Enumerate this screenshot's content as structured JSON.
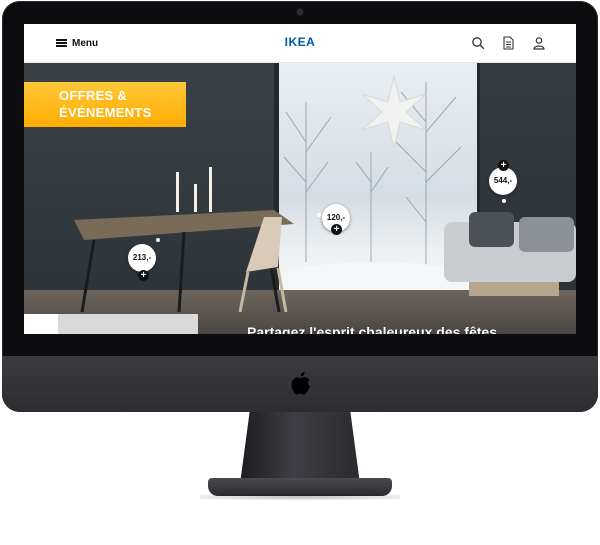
{
  "header": {
    "menu_label": "Menu",
    "logo_text": "IKEA",
    "icons": [
      "search-icon",
      "document-icon",
      "user-icon"
    ]
  },
  "hero": {
    "promo_title_line1": "OFFRES &",
    "promo_title_line2": "ÉVÉNEMENTS",
    "tagline": "Partagez l'esprit chaleureux des fêtes",
    "price_tags": [
      {
        "label": "213,-"
      },
      {
        "label": "120,-"
      },
      {
        "label": "544,-"
      }
    ]
  },
  "colors": {
    "brand_blue": "#0058a3",
    "promo_yellow": "#ffc83a",
    "promo_orange": "#ffad00"
  }
}
